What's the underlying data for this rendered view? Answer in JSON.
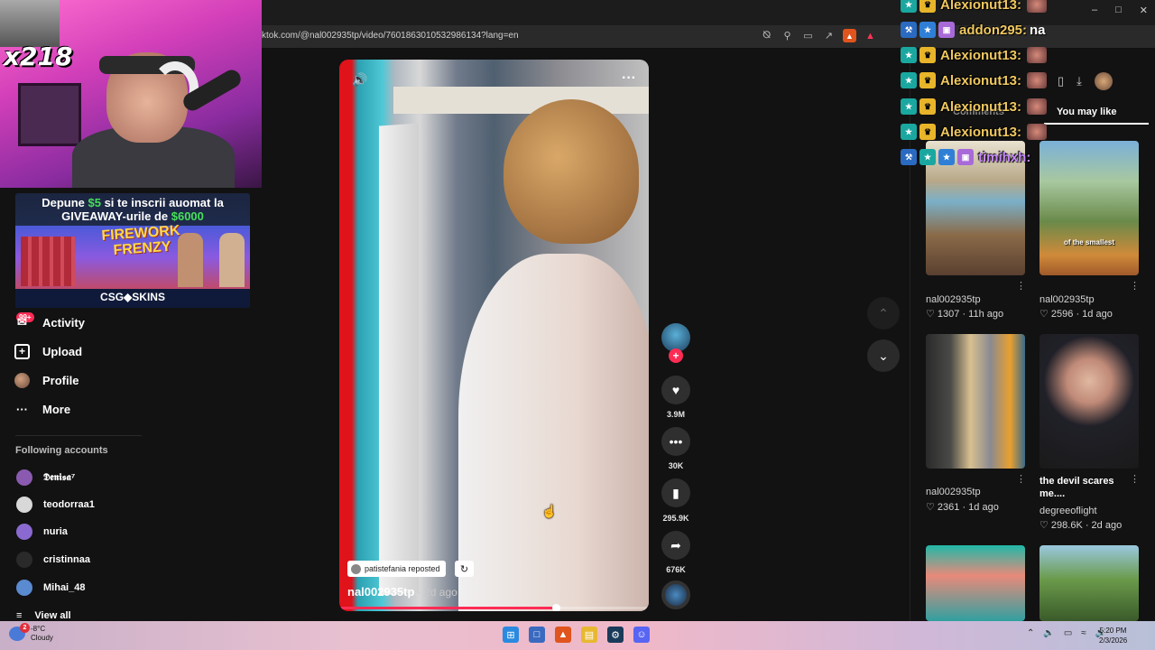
{
  "browser": {
    "url": "ktok.com/@nal002935tp/video/7601863010532986134?lang=en"
  },
  "stream_overlay": {
    "viewer_badge": "x218",
    "ad": {
      "line1_prefix": "Depune ",
      "line1_amount": "$5",
      "line1_suffix": " si te inscrii auomat la",
      "line2_prefix": "GIVEAWAY-urile de ",
      "line2_amount": "$6000",
      "game_title_1": "FIREWORK",
      "game_title_2": "FRENZY",
      "brand": "CSG◆SKINS"
    },
    "chat": [
      {
        "name": "Alexionut13:",
        "msg": ""
      },
      {
        "name": "addon295:",
        "msg": "na"
      },
      {
        "name": "Alexionut13:",
        "msg": ""
      },
      {
        "name": "Alexionut13:",
        "msg": ""
      },
      {
        "name": "Alexionut13:",
        "msg": ""
      },
      {
        "name": "Alexionut13:",
        "msg": ""
      },
      {
        "name": "timihxh:",
        "msg": ""
      }
    ]
  },
  "sidebar": {
    "activity_badge": "99+",
    "items": [
      {
        "label": "Activity",
        "icon": "activity-icon"
      },
      {
        "label": "Upload",
        "icon": "upload-icon"
      },
      {
        "label": "Profile",
        "icon": "profile-avatar"
      },
      {
        "label": "More",
        "icon": "more-icon"
      }
    ],
    "following_title": "Following accounts",
    "following": [
      {
        "name": "𝕯𝖊𝖓𝖎𝖘𝖆⁷",
        "color": "#8a5ab0"
      },
      {
        "name": "teodorraa1",
        "color": "#d8d8d8"
      },
      {
        "name": "nuria",
        "color": "#8a6ad0"
      },
      {
        "name": "cristinnaa",
        "color": "#2a2a2a"
      },
      {
        "name": "Mihai_48",
        "color": "#5a8ad0"
      }
    ],
    "view_all": "View all"
  },
  "video": {
    "reposted_by": "patistefania reposted",
    "author": "nal002935tp",
    "date": " · 2d ago",
    "progress": 0.7
  },
  "actions": {
    "likes": "3.9M",
    "comments": "30K",
    "saves": "295.9K",
    "shares": "676K"
  },
  "right_panel": {
    "tab_comments": "Comments",
    "tab_you_may_like": "You may like",
    "thumbs": [
      {
        "author": "nal002935tp",
        "meta": "1307 · 11h ago",
        "title": "",
        "overlay": ""
      },
      {
        "author": "nal002935tp",
        "meta": "2596 · 1d ago",
        "title": "",
        "overlay": "of the smallest"
      },
      {
        "author": "nal002935tp",
        "meta": "2361 · 1d ago",
        "title": "",
        "overlay": ""
      },
      {
        "author": "degreeoflight",
        "meta": "298.6K · 2d ago",
        "title": "the devil scares me....",
        "overlay": ""
      }
    ]
  },
  "taskbar": {
    "temperature": "-8°C",
    "weather": "Cloudy",
    "weather_badge": "2",
    "time": "5:20 PM",
    "date": "2/3/2026"
  }
}
